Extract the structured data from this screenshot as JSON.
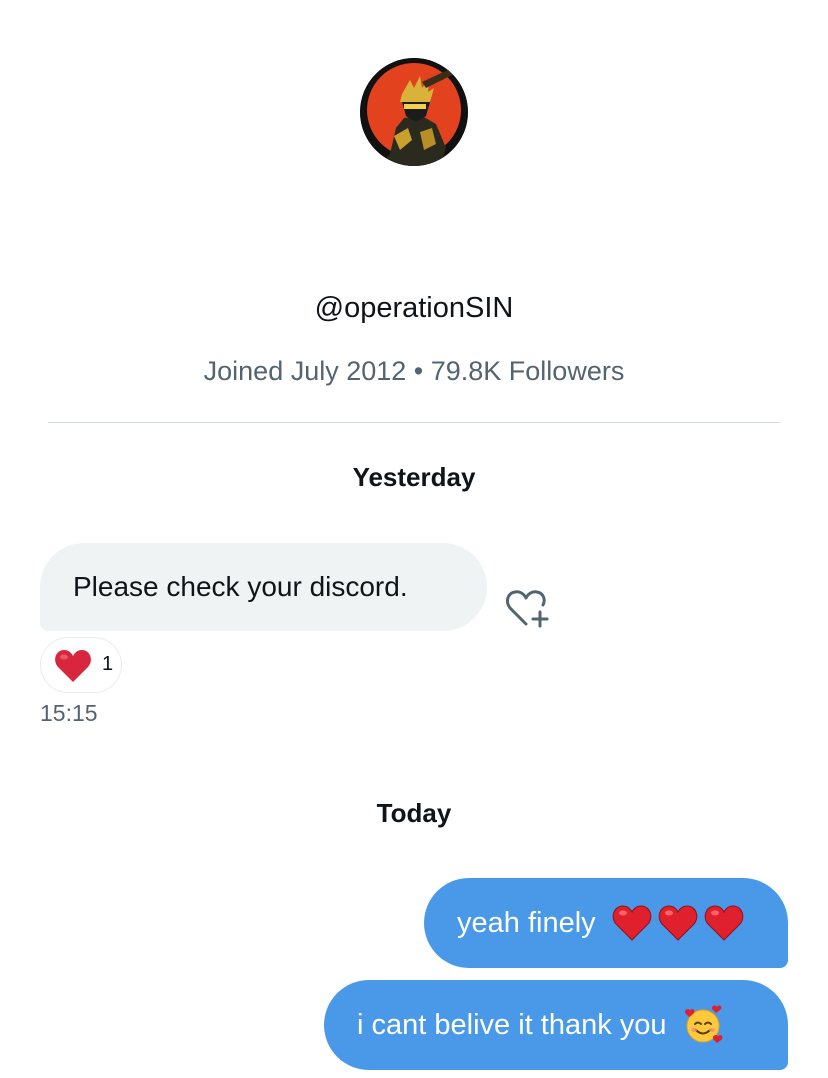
{
  "profile": {
    "handle": "@operationSIN",
    "meta": "Joined July 2012 • 79.8K Followers"
  },
  "conversation": {
    "yesterday_label": "Yesterday",
    "today_label": "Today",
    "incoming": {
      "text": "Please check your discord.",
      "reaction_count": "1",
      "time": "15:15"
    },
    "outgoing": [
      {
        "text": "yeah finely",
        "emoji": [
          "red-heart",
          "red-heart",
          "red-heart"
        ]
      },
      {
        "text": "i cant belive it thank you",
        "emoji": [
          "smiling-face-with-hearts"
        ]
      }
    ]
  },
  "colors": {
    "outgoing_bubble": "#4a99e9",
    "incoming_bubble": "#eff3f4",
    "secondary_text": "#536471",
    "heart_red": "#d7263d"
  }
}
